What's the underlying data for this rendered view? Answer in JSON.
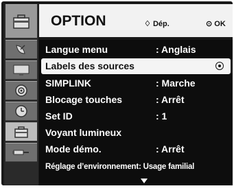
{
  "header": {
    "title": "OPTION",
    "hint_nav_symbol": "♢",
    "hint_nav_label": "Dép.",
    "hint_ok_symbol": "⊙",
    "hint_ok_label": "OK"
  },
  "sidebar": {
    "items": [
      {
        "icon": "option-toolbox-icon",
        "active": true
      },
      {
        "icon": "satellite-dish-icon",
        "active": false
      },
      {
        "icon": "monitor-icon",
        "active": false
      },
      {
        "icon": "speaker-icon",
        "active": false
      },
      {
        "icon": "clock-icon",
        "active": false
      },
      {
        "icon": "option-toolbox-icon",
        "active": true
      },
      {
        "icon": "input-plug-icon",
        "active": false
      }
    ]
  },
  "menu": {
    "rows": [
      {
        "label": "Langue menu",
        "value": ": Anglais",
        "selected": false
      },
      {
        "label": "Labels des sources",
        "value": "",
        "selected": true
      },
      {
        "label": "SIMPLINK",
        "value": ": Marche",
        "selected": false
      },
      {
        "label": "Blocage touches",
        "value": ": Arrêt",
        "selected": false
      },
      {
        "label": "Set ID",
        "value": ": 1",
        "selected": false
      },
      {
        "label": "Voyant lumineux",
        "value": "",
        "selected": false
      },
      {
        "label": "Mode démo.",
        "value": ": Arrêt",
        "selected": false
      },
      {
        "label": "Réglage d’environnement: Usage familial",
        "value": "",
        "selected": false
      }
    ]
  }
}
